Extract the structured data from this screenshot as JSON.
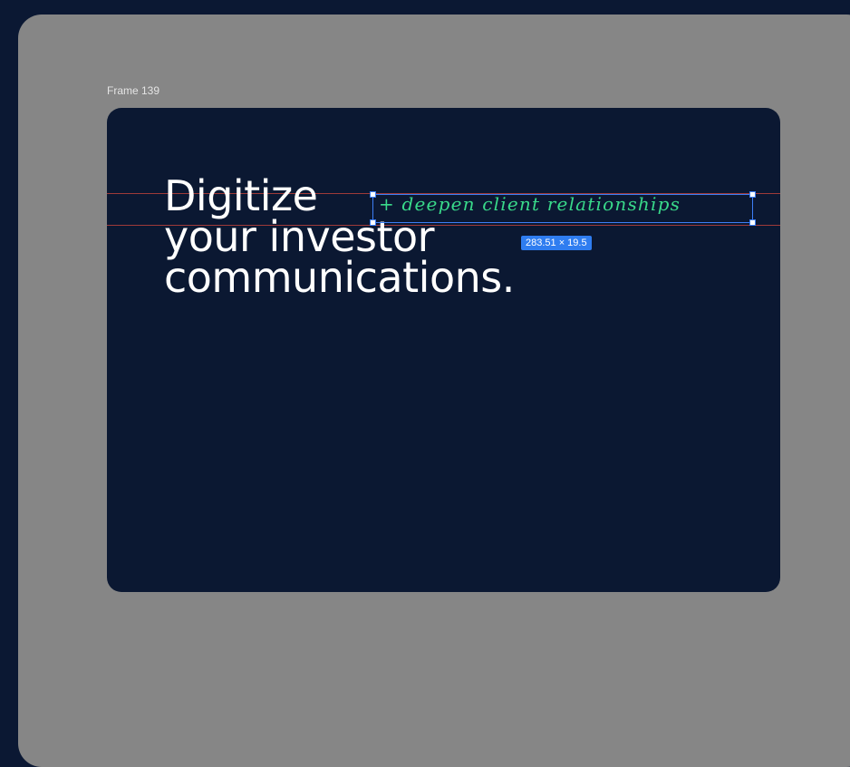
{
  "canvas": {
    "frame_label": "Frame 139"
  },
  "frame": {
    "headline": {
      "line1": "Digitize",
      "line2": "your investor",
      "line3": "communications."
    },
    "annotation": "+ deepen client relationships",
    "selection_dimensions": "283.51 × 19.5"
  },
  "colors": {
    "page_background": "#0b1833",
    "canvas": "#868686",
    "frame_fill": "#0b1832",
    "headline_text": "#ffffff",
    "annotation_text": "#39d98a",
    "selection": "#3d7ef5",
    "guide_lines": "#d2463c"
  }
}
